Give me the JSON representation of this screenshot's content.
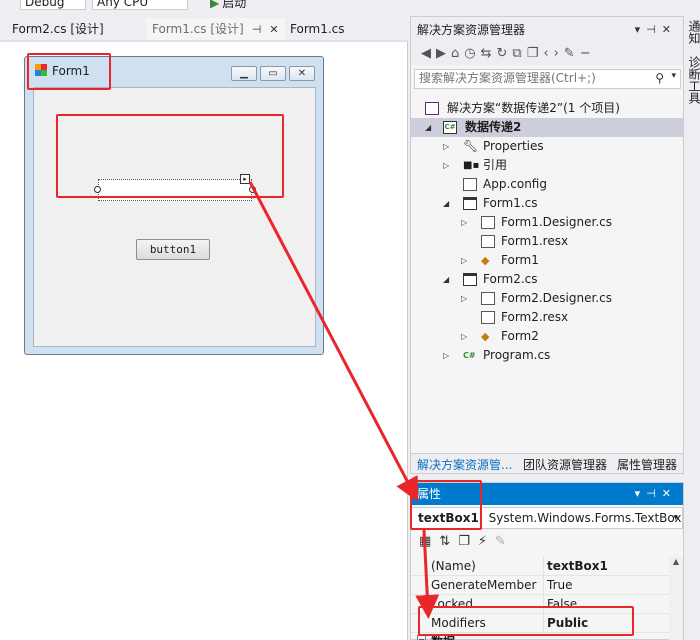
{
  "toolbar": {
    "config": "Debug",
    "platform": "Any CPU",
    "start_label": "启动"
  },
  "doc_tabs": [
    {
      "label": "Form2.cs [设计]"
    },
    {
      "label": "Form1.cs [设计]"
    },
    {
      "label": "Form1.cs"
    }
  ],
  "designer": {
    "form_title": "Form1",
    "button_text": "button1"
  },
  "solution_explorer": {
    "title": "解决方案资源管理器",
    "search_placeholder": "搜索解决方案资源管理器(Ctrl+;)",
    "tree": [
      {
        "label": "解决方案“数据传递2”(1 个项目)",
        "icon": "solution-icon"
      },
      {
        "label": "数据传递2",
        "icon": "csharp-project-icon",
        "selected": true
      },
      {
        "label": "Properties",
        "icon": "wrench-icon"
      },
      {
        "label": "引用",
        "icon": "references-icon"
      },
      {
        "label": "App.config",
        "icon": "config-file-icon"
      },
      {
        "label": "Form1.cs",
        "icon": "form-icon"
      },
      {
        "label": "Form1.Designer.cs",
        "icon": "cs-file-icon"
      },
      {
        "label": "Form1.resx",
        "icon": "resx-file-icon"
      },
      {
        "label": "Form1",
        "icon": "class-icon"
      },
      {
        "label": "Form2.cs",
        "icon": "form-icon"
      },
      {
        "label": "Form2.Designer.cs",
        "icon": "cs-file-icon"
      },
      {
        "label": "Form2.resx",
        "icon": "resx-file-icon"
      },
      {
        "label": "Form2",
        "icon": "class-icon"
      },
      {
        "label": "Program.cs",
        "icon": "csharp-file-icon"
      }
    ],
    "bottom_tabs": [
      "解决方案资源管...",
      "团队资源管理器",
      "属性管理器"
    ]
  },
  "properties": {
    "title": "属性",
    "object_name": "textBox1",
    "object_type": "System.Windows.Forms.TextBox",
    "rows": [
      {
        "name": "(Name)",
        "value": "textBox1",
        "bold": true
      },
      {
        "name": "GenerateMember",
        "value": "True",
        "bold": false
      },
      {
        "name": "Locked",
        "value": "False",
        "bold": false
      },
      {
        "name": "Modifiers",
        "value": "Public",
        "bold": true
      }
    ],
    "category": "数据"
  },
  "right_strip": {
    "item1": "通知",
    "item2": "诊断工具"
  },
  "colors": {
    "accent": "#007acc",
    "annotation_red": "#e8262b",
    "selection": "#cccedb"
  }
}
